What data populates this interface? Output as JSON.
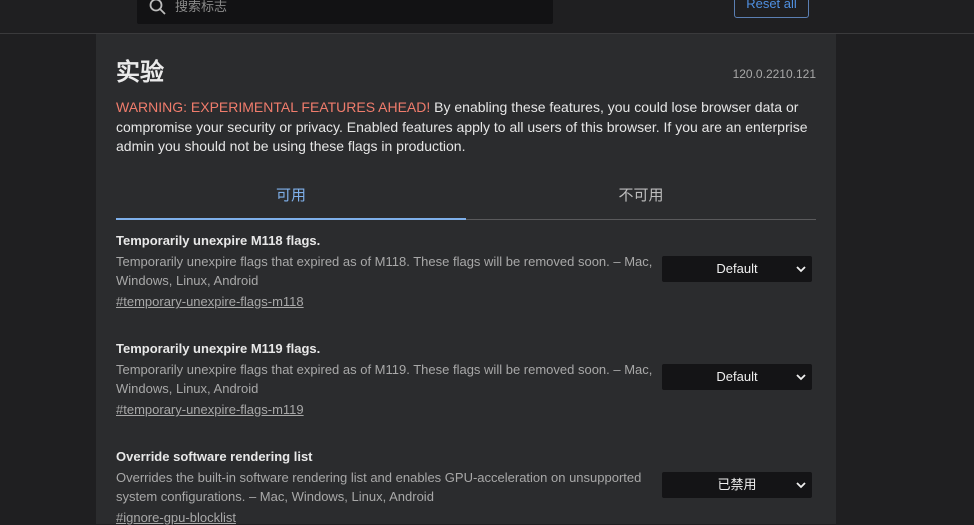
{
  "header": {
    "search_placeholder": "搜索标志",
    "reset_label": "Reset all"
  },
  "page": {
    "title": "实验",
    "version": "120.0.2210.121",
    "warning_prefix": "WARNING: EXPERIMENTAL FEATURES AHEAD!",
    "warning_text": " By enabling these features, you could lose browser data or compromise your security or privacy. Enabled features apply to all users of this browser. If you are an enterprise admin you should not be using these flags in production."
  },
  "tabs": [
    {
      "label": "可用",
      "active": true
    },
    {
      "label": "不可用",
      "active": false
    }
  ],
  "flags": [
    {
      "name": "Temporarily unexpire M118 flags.",
      "description": "Temporarily unexpire flags that expired as of M118. These flags will be removed soon. – Mac, Windows, Linux, Android",
      "link": "#temporary-unexpire-flags-m118",
      "value": "Default"
    },
    {
      "name": "Temporarily unexpire M119 flags.",
      "description": "Temporarily unexpire flags that expired as of M119. These flags will be removed soon. – Mac, Windows, Linux, Android",
      "link": "#temporary-unexpire-flags-m119",
      "value": "Default"
    },
    {
      "name": "Override software rendering list",
      "description": "Overrides the built-in software rendering list and enables GPU-acceleration on unsupported system configurations. – Mac, Windows, Linux, Android",
      "link": "#ignore-gpu-blocklist",
      "value": "已禁用"
    }
  ],
  "colors": {
    "background": "#1f1f21",
    "panel": "#2b2c2e",
    "accent": "#7fb0ea",
    "warning": "#f07c6c"
  }
}
